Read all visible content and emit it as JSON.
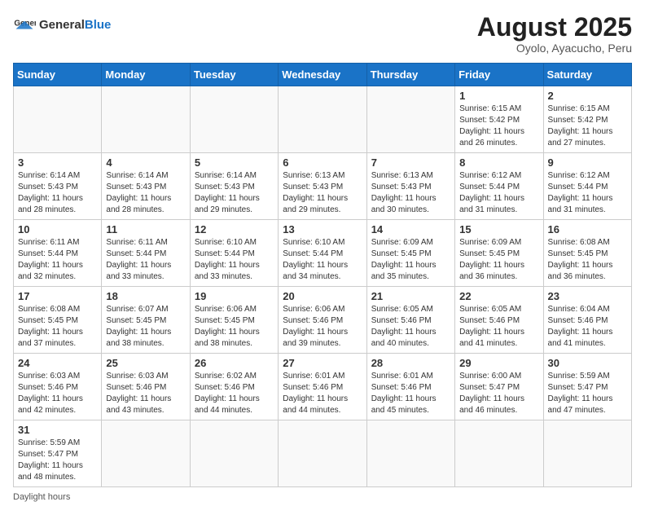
{
  "header": {
    "logo_general": "General",
    "logo_blue": "Blue",
    "month_year": "August 2025",
    "location": "Oyolo, Ayacucho, Peru"
  },
  "days_of_week": [
    "Sunday",
    "Monday",
    "Tuesday",
    "Wednesday",
    "Thursday",
    "Friday",
    "Saturday"
  ],
  "weeks": [
    [
      {
        "day": "",
        "info": ""
      },
      {
        "day": "",
        "info": ""
      },
      {
        "day": "",
        "info": ""
      },
      {
        "day": "",
        "info": ""
      },
      {
        "day": "",
        "info": ""
      },
      {
        "day": "1",
        "info": "Sunrise: 6:15 AM\nSunset: 5:42 PM\nDaylight: 11 hours and 26 minutes."
      },
      {
        "day": "2",
        "info": "Sunrise: 6:15 AM\nSunset: 5:42 PM\nDaylight: 11 hours and 27 minutes."
      }
    ],
    [
      {
        "day": "3",
        "info": "Sunrise: 6:14 AM\nSunset: 5:43 PM\nDaylight: 11 hours and 28 minutes."
      },
      {
        "day": "4",
        "info": "Sunrise: 6:14 AM\nSunset: 5:43 PM\nDaylight: 11 hours and 28 minutes."
      },
      {
        "day": "5",
        "info": "Sunrise: 6:14 AM\nSunset: 5:43 PM\nDaylight: 11 hours and 29 minutes."
      },
      {
        "day": "6",
        "info": "Sunrise: 6:13 AM\nSunset: 5:43 PM\nDaylight: 11 hours and 29 minutes."
      },
      {
        "day": "7",
        "info": "Sunrise: 6:13 AM\nSunset: 5:43 PM\nDaylight: 11 hours and 30 minutes."
      },
      {
        "day": "8",
        "info": "Sunrise: 6:12 AM\nSunset: 5:44 PM\nDaylight: 11 hours and 31 minutes."
      },
      {
        "day": "9",
        "info": "Sunrise: 6:12 AM\nSunset: 5:44 PM\nDaylight: 11 hours and 31 minutes."
      }
    ],
    [
      {
        "day": "10",
        "info": "Sunrise: 6:11 AM\nSunset: 5:44 PM\nDaylight: 11 hours and 32 minutes."
      },
      {
        "day": "11",
        "info": "Sunrise: 6:11 AM\nSunset: 5:44 PM\nDaylight: 11 hours and 33 minutes."
      },
      {
        "day": "12",
        "info": "Sunrise: 6:10 AM\nSunset: 5:44 PM\nDaylight: 11 hours and 33 minutes."
      },
      {
        "day": "13",
        "info": "Sunrise: 6:10 AM\nSunset: 5:44 PM\nDaylight: 11 hours and 34 minutes."
      },
      {
        "day": "14",
        "info": "Sunrise: 6:09 AM\nSunset: 5:45 PM\nDaylight: 11 hours and 35 minutes."
      },
      {
        "day": "15",
        "info": "Sunrise: 6:09 AM\nSunset: 5:45 PM\nDaylight: 11 hours and 36 minutes."
      },
      {
        "day": "16",
        "info": "Sunrise: 6:08 AM\nSunset: 5:45 PM\nDaylight: 11 hours and 36 minutes."
      }
    ],
    [
      {
        "day": "17",
        "info": "Sunrise: 6:08 AM\nSunset: 5:45 PM\nDaylight: 11 hours and 37 minutes."
      },
      {
        "day": "18",
        "info": "Sunrise: 6:07 AM\nSunset: 5:45 PM\nDaylight: 11 hours and 38 minutes."
      },
      {
        "day": "19",
        "info": "Sunrise: 6:06 AM\nSunset: 5:45 PM\nDaylight: 11 hours and 38 minutes."
      },
      {
        "day": "20",
        "info": "Sunrise: 6:06 AM\nSunset: 5:46 PM\nDaylight: 11 hours and 39 minutes."
      },
      {
        "day": "21",
        "info": "Sunrise: 6:05 AM\nSunset: 5:46 PM\nDaylight: 11 hours and 40 minutes."
      },
      {
        "day": "22",
        "info": "Sunrise: 6:05 AM\nSunset: 5:46 PM\nDaylight: 11 hours and 41 minutes."
      },
      {
        "day": "23",
        "info": "Sunrise: 6:04 AM\nSunset: 5:46 PM\nDaylight: 11 hours and 41 minutes."
      }
    ],
    [
      {
        "day": "24",
        "info": "Sunrise: 6:03 AM\nSunset: 5:46 PM\nDaylight: 11 hours and 42 minutes."
      },
      {
        "day": "25",
        "info": "Sunrise: 6:03 AM\nSunset: 5:46 PM\nDaylight: 11 hours and 43 minutes."
      },
      {
        "day": "26",
        "info": "Sunrise: 6:02 AM\nSunset: 5:46 PM\nDaylight: 11 hours and 44 minutes."
      },
      {
        "day": "27",
        "info": "Sunrise: 6:01 AM\nSunset: 5:46 PM\nDaylight: 11 hours and 44 minutes."
      },
      {
        "day": "28",
        "info": "Sunrise: 6:01 AM\nSunset: 5:46 PM\nDaylight: 11 hours and 45 minutes."
      },
      {
        "day": "29",
        "info": "Sunrise: 6:00 AM\nSunset: 5:47 PM\nDaylight: 11 hours and 46 minutes."
      },
      {
        "day": "30",
        "info": "Sunrise: 5:59 AM\nSunset: 5:47 PM\nDaylight: 11 hours and 47 minutes."
      }
    ],
    [
      {
        "day": "31",
        "info": "Sunrise: 5:59 AM\nSunset: 5:47 PM\nDaylight: 11 hours and 48 minutes."
      },
      {
        "day": "",
        "info": ""
      },
      {
        "day": "",
        "info": ""
      },
      {
        "day": "",
        "info": ""
      },
      {
        "day": "",
        "info": ""
      },
      {
        "day": "",
        "info": ""
      },
      {
        "day": "",
        "info": ""
      }
    ]
  ],
  "footer": {
    "daylight_label": "Daylight hours"
  }
}
